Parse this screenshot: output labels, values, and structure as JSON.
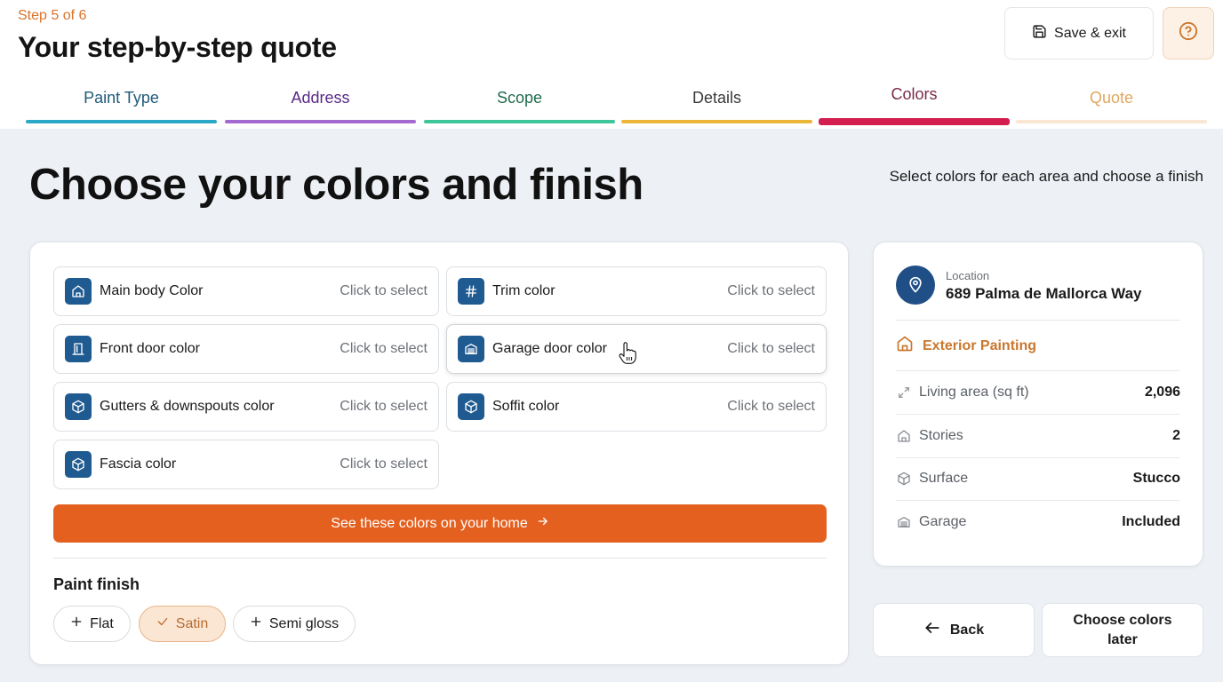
{
  "header": {
    "step_label": "Step 5 of 6",
    "title": "Your step-by-step quote",
    "save_exit_label": "Save & exit",
    "save_icon": "floppy-disk-icon",
    "help_icon": "question-circle-icon"
  },
  "tabs": [
    {
      "label": "Paint Type",
      "color": "#2aa8c6",
      "text_color": "#1f5a7a",
      "active": false
    },
    {
      "label": "Address",
      "color": "#a36ad0",
      "text_color": "#5b2a86",
      "active": false
    },
    {
      "label": "Scope",
      "color": "#3fc59a",
      "text_color": "#1f6b4d",
      "active": false
    },
    {
      "label": "Details",
      "color": "#eab73a",
      "text_color": "#3a3a3a",
      "active": false
    },
    {
      "label": "Colors",
      "color": "#d21f50",
      "text_color": "#7a2a4a",
      "active": true
    },
    {
      "label": "Quote",
      "color": "#f9e6d3",
      "text_color": "#e0a75e",
      "active": false
    }
  ],
  "main": {
    "title": "Choose your colors and finish",
    "subtitle": "Select colors for each area and choose a finish"
  },
  "color_items": [
    {
      "label": "Main body Color",
      "action": "Click to select",
      "icon": "house-icon"
    },
    {
      "label": "Trim color",
      "action": "Click to select",
      "icon": "hash-icon"
    },
    {
      "label": "Front door color",
      "action": "Click to select",
      "icon": "door-icon"
    },
    {
      "label": "Garage door color",
      "action": "Click to select",
      "icon": "garage-icon"
    },
    {
      "label": "Gutters & downspouts color",
      "action": "Click to select",
      "icon": "cube-icon"
    },
    {
      "label": "Soffit color",
      "action": "Click to select",
      "icon": "cube-icon"
    },
    {
      "label": "Fascia color",
      "action": "Click to select",
      "icon": "cube-icon"
    }
  ],
  "cta": {
    "label": "See these colors on your home",
    "icon": "arrow-right-icon"
  },
  "finish": {
    "title": "Paint finish",
    "options": [
      {
        "label": "Flat",
        "selected": false,
        "icon": "plus-icon"
      },
      {
        "label": "Satin",
        "selected": true,
        "icon": "check-icon"
      },
      {
        "label": "Semi gloss",
        "selected": false,
        "icon": "plus-icon"
      }
    ]
  },
  "summary": {
    "location_label": "Location",
    "location_value": "689 Palma de Mallorca Way",
    "service": "Exterior Painting",
    "rows": [
      {
        "label": "Living area (sq ft)",
        "value": "2,096",
        "icon": "resize-arrows-icon"
      },
      {
        "label": "Stories",
        "value": "2",
        "icon": "house-outline-icon"
      },
      {
        "label": "Surface",
        "value": "Stucco",
        "icon": "cube-outline-icon"
      },
      {
        "label": "Garage",
        "value": "Included",
        "icon": "garage-outline-icon"
      }
    ]
  },
  "nav": {
    "back_label": "Back",
    "later_label": "Choose colors later"
  },
  "colors": {
    "accent": "#e4601f",
    "icon_bg": "#1f5a91",
    "service_text": "#c9772e"
  }
}
